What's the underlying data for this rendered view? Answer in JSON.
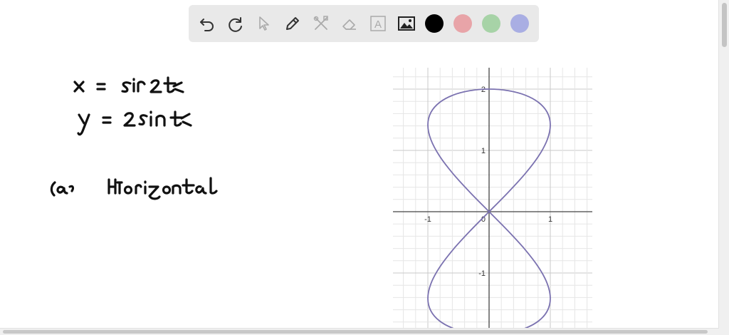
{
  "toolbar": {
    "tools": [
      "undo-icon",
      "redo-icon",
      "select-pointer-icon",
      "pen-icon",
      "tools-icon",
      "eraser-icon",
      "text-box-icon",
      "image-icon"
    ],
    "text_tool_glyph": "A",
    "colors": [
      "#000000",
      "#e8a4a8",
      "#a7d3a7",
      "#a9aee3"
    ]
  },
  "chart_data": {
    "type": "line",
    "curve": "parametric",
    "x_expression": "sin 2t",
    "y_expression": "2 sin t",
    "x_range": [
      -1.5,
      1.5
    ],
    "y_range": [
      -2.1,
      2.3
    ],
    "x_ticks": [
      -1,
      1
    ],
    "y_ticks": [
      2,
      1,
      -1
    ],
    "origin_label": "0",
    "grid": true,
    "line_color": "#7b72b0",
    "points": [
      [
        0.0,
        0.0
      ],
      [
        0.309,
        0.313
      ],
      [
        0.588,
        0.618
      ],
      [
        0.809,
        0.908
      ],
      [
        0.951,
        1.176
      ],
      [
        1.0,
        1.414
      ],
      [
        0.951,
        1.618
      ],
      [
        0.809,
        1.782
      ],
      [
        0.588,
        1.902
      ],
      [
        0.309,
        1.975
      ],
      [
        0.0,
        2.0
      ],
      [
        -0.309,
        1.975
      ],
      [
        -0.588,
        1.902
      ],
      [
        -0.809,
        1.782
      ],
      [
        -0.951,
        1.618
      ],
      [
        -1.0,
        1.414
      ],
      [
        -0.951,
        1.176
      ],
      [
        -0.809,
        0.908
      ],
      [
        -0.588,
        0.618
      ],
      [
        -0.309,
        0.313
      ],
      [
        0.0,
        0.0
      ],
      [
        0.309,
        -0.313
      ],
      [
        0.588,
        -0.618
      ],
      [
        0.809,
        -0.908
      ],
      [
        0.951,
        -1.176
      ],
      [
        1.0,
        -1.414
      ],
      [
        0.951,
        -1.618
      ],
      [
        0.809,
        -1.782
      ],
      [
        0.588,
        -1.902
      ],
      [
        0.309,
        -1.975
      ],
      [
        0.0,
        -2.0
      ],
      [
        -0.309,
        -1.975
      ],
      [
        -0.588,
        -1.902
      ],
      [
        -0.809,
        -1.782
      ],
      [
        -0.951,
        -1.618
      ],
      [
        -1.0,
        -1.414
      ],
      [
        -0.951,
        -1.176
      ],
      [
        -0.809,
        -0.908
      ],
      [
        -0.588,
        -0.618
      ],
      [
        -0.309,
        -0.313
      ],
      [
        0.0,
        0.0
      ]
    ]
  }
}
